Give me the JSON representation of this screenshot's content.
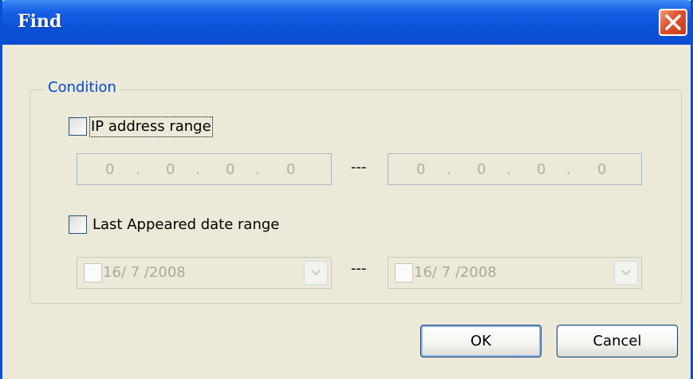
{
  "window": {
    "title": "Find",
    "close_icon": "close-icon"
  },
  "condition": {
    "title": "Condition",
    "ip_range": {
      "label": "IP address range",
      "checked": false,
      "from": [
        "0",
        "0",
        "0",
        "0"
      ],
      "to": [
        "0",
        "0",
        "0",
        "0"
      ],
      "separator": "---"
    },
    "date_range": {
      "label": "Last Appeared date range",
      "checked": false,
      "from": "16/ 7 /2008",
      "to": "16/ 7 /2008",
      "separator": "---"
    }
  },
  "buttons": {
    "ok": "OK",
    "cancel": "Cancel"
  },
  "colors": {
    "title_bar": "#0a52d8",
    "group_title": "#0046d5",
    "close_button": "#e0502c",
    "window_bg": "#ece9d8"
  }
}
